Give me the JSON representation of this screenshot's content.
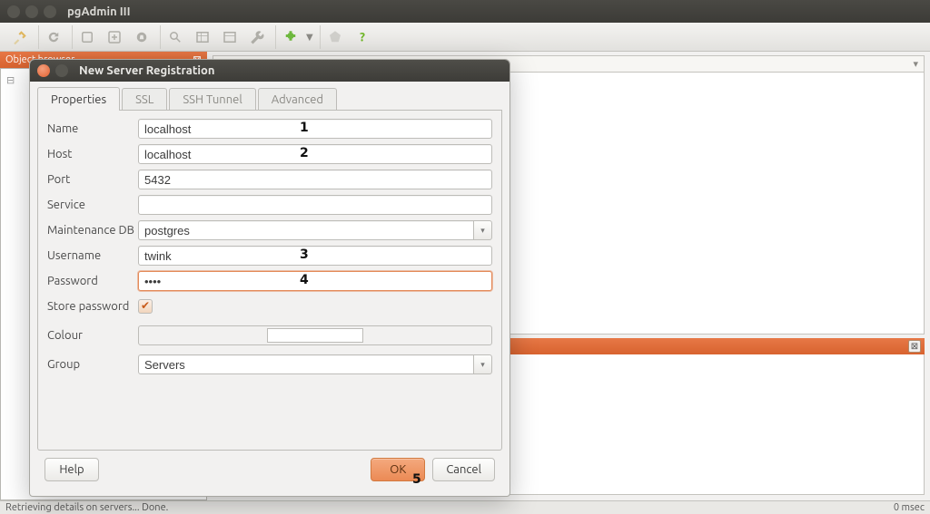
{
  "window": {
    "title": "pgAdmin III"
  },
  "object_browser": {
    "title": "Object browser",
    "tree_root": "⊟"
  },
  "dialog": {
    "title": "New Server Registration",
    "tabs": {
      "properties": "Properties",
      "ssl": "SSL",
      "ssh": "SSH Tunnel",
      "advanced": "Advanced"
    },
    "labels": {
      "name": "Name",
      "host": "Host",
      "port": "Port",
      "service": "Service",
      "maintenance_db": "Maintenance DB",
      "username": "Username",
      "password": "Password",
      "store_password": "Store password",
      "colour": "Colour",
      "group": "Group"
    },
    "values": {
      "name": "localhost",
      "host": "localhost",
      "port": "5432",
      "service": "",
      "maintenance_db": "postgres",
      "username": "twink",
      "password": "••••",
      "group": "Servers"
    },
    "footer": {
      "help": "Help",
      "ok": "OK",
      "cancel": "Cancel"
    }
  },
  "annotations": {
    "a1": "1",
    "a2": "2",
    "a3": "3",
    "a4": "4",
    "a5": "5"
  },
  "statusbar": {
    "left": "Retrieving details on servers... Done.",
    "right": "0 msec"
  }
}
